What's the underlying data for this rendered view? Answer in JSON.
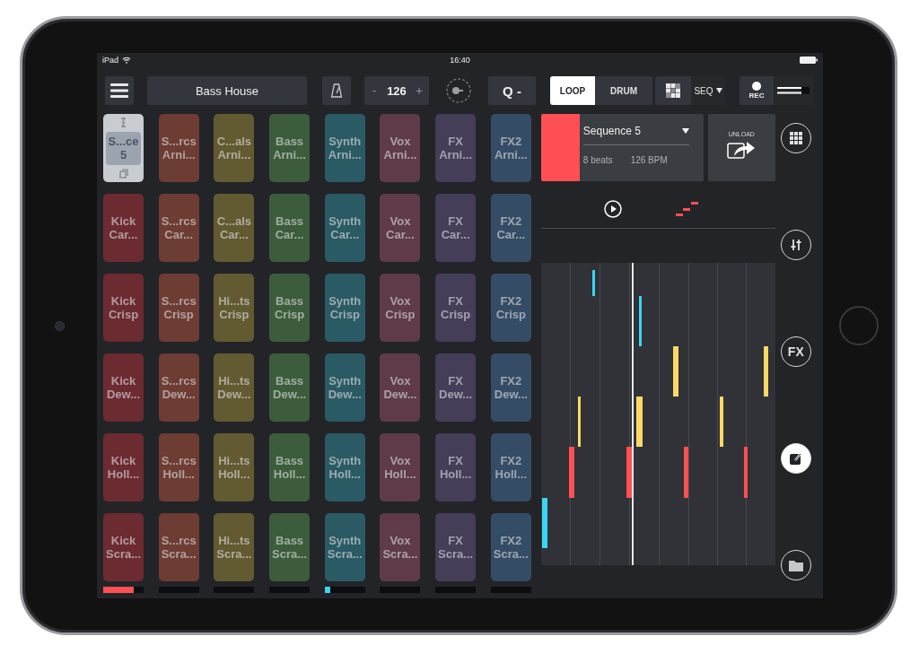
{
  "status_bar": {
    "carrier": "iPad",
    "time": "16:40"
  },
  "toolbar": {
    "project": "Bass House",
    "tempo": {
      "decrement": "-",
      "value": "126",
      "increment": "+"
    },
    "quantize": "Q -",
    "modes": [
      {
        "label": "LOOP",
        "selected": true
      },
      {
        "label": "DRUM",
        "selected": false
      }
    ],
    "view": "SEQ",
    "record": "REC"
  },
  "columns": [
    {
      "color": "#6b2b30",
      "meter": {
        "level": 0.76,
        "color": "#ff4f52"
      },
      "pads": [
        {
          "title": "S...ce",
          "subtitle": "5",
          "selected": true
        },
        {
          "title": "Kick",
          "subtitle": "Car...",
          "selected": false
        },
        {
          "title": "Kick",
          "subtitle": "Crisp",
          "selected": false
        },
        {
          "title": "Kick",
          "subtitle": "Dew...",
          "selected": false
        },
        {
          "title": "Kick",
          "subtitle": "Holl...",
          "selected": false
        },
        {
          "title": "Kick",
          "subtitle": "Scra...",
          "selected": false
        }
      ]
    },
    {
      "color": "#6d3c33",
      "pads": [
        {
          "title": "S...rcs",
          "subtitle": "Arni...",
          "selected": false
        },
        {
          "title": "S...rcs",
          "subtitle": "Car...",
          "selected": false
        },
        {
          "title": "S...rcs",
          "subtitle": "Crisp",
          "selected": false
        },
        {
          "title": "S...rcs",
          "subtitle": "Dew...",
          "selected": false
        },
        {
          "title": "S...rcs",
          "subtitle": "Holl...",
          "selected": false
        },
        {
          "title": "S...rcs",
          "subtitle": "Scra...",
          "selected": false
        }
      ]
    },
    {
      "color": "#625a30",
      "pads": [
        {
          "title": "C...als",
          "subtitle": "Arni...",
          "selected": false
        },
        {
          "title": "C...als",
          "subtitle": "Car...",
          "selected": false
        },
        {
          "title": "Hi...ts",
          "subtitle": "Crisp",
          "selected": false
        },
        {
          "title": "Hi...ts",
          "subtitle": "Dew...",
          "selected": false
        },
        {
          "title": "Hi...ts",
          "subtitle": "Holl...",
          "selected": false
        },
        {
          "title": "Hi...ts",
          "subtitle": "Scra...",
          "selected": false
        }
      ]
    },
    {
      "color": "#3c5c3b",
      "pads": [
        {
          "title": "Bass",
          "subtitle": "Arni...",
          "selected": false
        },
        {
          "title": "Bass",
          "subtitle": "Car...",
          "selected": false
        },
        {
          "title": "Bass",
          "subtitle": "Crisp",
          "selected": false
        },
        {
          "title": "Bass",
          "subtitle": "Dew...",
          "selected": false
        },
        {
          "title": "Bass",
          "subtitle": "Holl...",
          "selected": false
        },
        {
          "title": "Bass",
          "subtitle": "Scra...",
          "selected": false
        }
      ]
    },
    {
      "color": "#2a5a63",
      "meter": {
        "level": 0.14,
        "color": "#3ad6f0"
      },
      "pads": [
        {
          "title": "Synth",
          "subtitle": "Arni...",
          "selected": false
        },
        {
          "title": "Synth",
          "subtitle": "Car...",
          "selected": false
        },
        {
          "title": "Synth",
          "subtitle": "Crisp",
          "selected": false
        },
        {
          "title": "Synth",
          "subtitle": "Dew...",
          "selected": false
        },
        {
          "title": "Synth",
          "subtitle": "Holl...",
          "selected": false
        },
        {
          "title": "Synth",
          "subtitle": "Scra...",
          "selected": false
        }
      ]
    },
    {
      "color": "#5e3a4b",
      "pads": [
        {
          "title": "Vox",
          "subtitle": "Arni...",
          "selected": false
        },
        {
          "title": "Vox",
          "subtitle": "Car...",
          "selected": false
        },
        {
          "title": "Vox",
          "subtitle": "Crisp",
          "selected": false
        },
        {
          "title": "Vox",
          "subtitle": "Dew...",
          "selected": false
        },
        {
          "title": "Vox",
          "subtitle": "Holl...",
          "selected": false
        },
        {
          "title": "Vox",
          "subtitle": "Scra...",
          "selected": false
        }
      ]
    },
    {
      "color": "#463d58",
      "pads": [
        {
          "title": "FX",
          "subtitle": "Arni...",
          "selected": false
        },
        {
          "title": "FX",
          "subtitle": "Car...",
          "selected": false
        },
        {
          "title": "FX",
          "subtitle": "Crisp",
          "selected": false
        },
        {
          "title": "FX",
          "subtitle": "Dew...",
          "selected": false
        },
        {
          "title": "FX",
          "subtitle": "Holl...",
          "selected": false
        },
        {
          "title": "FX",
          "subtitle": "Scra...",
          "selected": false
        }
      ]
    },
    {
      "color": "#344c65",
      "pads": [
        {
          "title": "FX2",
          "subtitle": "Arni...",
          "selected": false
        },
        {
          "title": "FX2",
          "subtitle": "Car...",
          "selected": false
        },
        {
          "title": "FX2",
          "subtitle": "Crisp",
          "selected": false
        },
        {
          "title": "FX2",
          "subtitle": "Dew...",
          "selected": false
        },
        {
          "title": "FX2",
          "subtitle": "Holl...",
          "selected": false
        },
        {
          "title": "FX2",
          "subtitle": "Scra...",
          "selected": false
        }
      ]
    }
  ],
  "sequence": {
    "name": "Sequence 5",
    "beats": "8 beats",
    "bpm": "126 BPM",
    "color": "#ff4f52"
  },
  "unload": "UNLOAD",
  "side_buttons": [
    {
      "kind": "grid",
      "selected": false
    },
    {
      "kind": "mixer",
      "selected": false
    },
    {
      "kind": "fx",
      "label": "FX",
      "selected": false
    },
    {
      "kind": "edit",
      "selected": true
    },
    {
      "kind": "folder",
      "selected": false
    }
  ]
}
